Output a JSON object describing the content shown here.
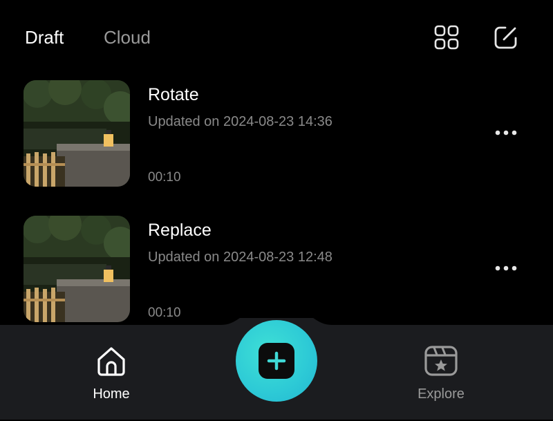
{
  "tabs": [
    {
      "label": "Draft",
      "active": true
    },
    {
      "label": "Cloud",
      "active": false
    }
  ],
  "toolbar": {
    "grid_icon": "grid-view-icon",
    "edit_icon": "edit-square-icon"
  },
  "drafts": [
    {
      "title": "Rotate",
      "updated": "Updated on 2024-08-23 14:36",
      "duration": "00:10"
    },
    {
      "title": "Replace",
      "updated": "Updated on 2024-08-23 12:48",
      "duration": "00:10"
    }
  ],
  "nav": {
    "home_label": "Home",
    "explore_label": "Explore",
    "create_icon": "plus-icon"
  },
  "colors": {
    "background": "#000000",
    "nav_background": "#1b1c1f",
    "accent": "#2ecbd6",
    "secondary_text": "#8a8a8a"
  }
}
